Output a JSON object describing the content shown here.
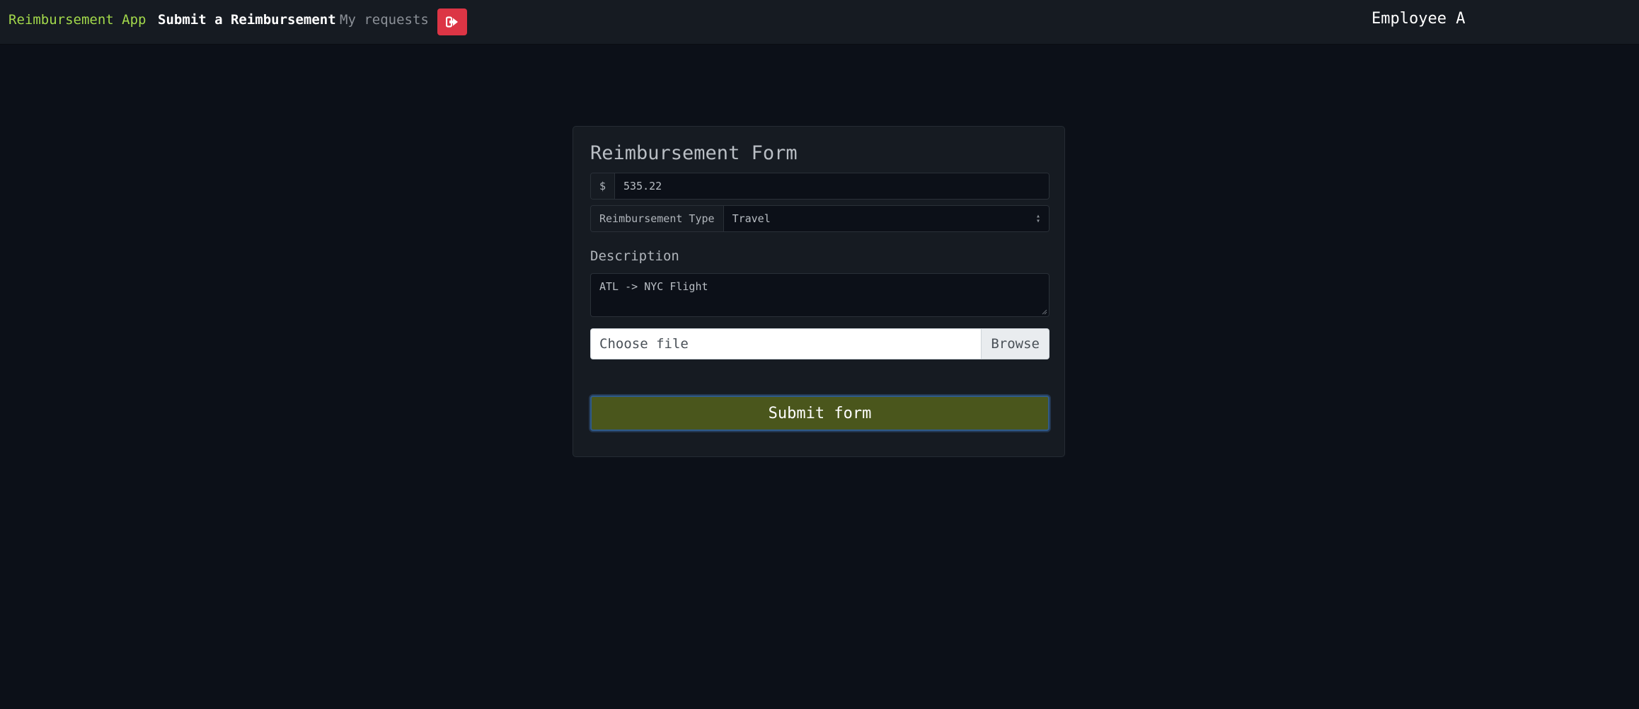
{
  "navbar": {
    "brand": "Reimbursement App",
    "links": [
      {
        "label": "Submit a Reimbursement",
        "active": true
      },
      {
        "label": "My requests",
        "active": false
      }
    ],
    "logout_icon": "sign-out-icon",
    "user": "Employee A"
  },
  "form": {
    "title": "Reimbursement Form",
    "amount": {
      "prefix": "$",
      "value": "535.22"
    },
    "type": {
      "label": "Reimbursement Type",
      "selected": "Travel"
    },
    "description": {
      "label": "Description",
      "value": "ATL -> NYC Flight"
    },
    "file": {
      "label": "Choose file",
      "browse": "Browse"
    },
    "submit_label": "Submit form"
  },
  "colors": {
    "brand": "#a3d94b",
    "logout_button": "#dc3545",
    "submit_button": "#4a561c",
    "background": "#0c1018",
    "card": "#161b22"
  }
}
